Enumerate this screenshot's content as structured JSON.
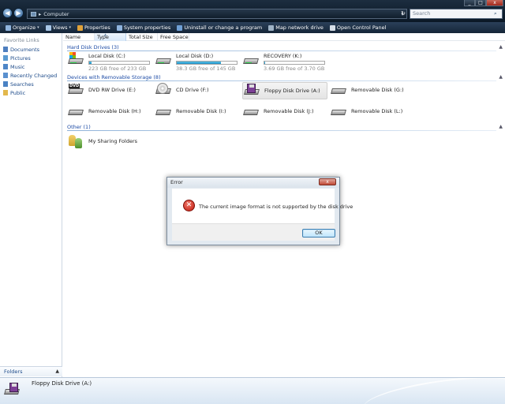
{
  "window": {
    "min_glyph": "_",
    "max_glyph": "□",
    "close_glyph": "x"
  },
  "address": {
    "back_glyph": "◀",
    "forward_glyph": "▶",
    "path": "Computer",
    "separator": "▸",
    "dropdown_glyph": "▾",
    "refresh_glyph": "↻",
    "search_placeholder": "Search",
    "search_glyph": "⌕"
  },
  "toolbar": {
    "items": [
      {
        "label": "Organize",
        "icon": "organize-icon",
        "color": "#8fb4de",
        "caret": "▾"
      },
      {
        "label": "Views",
        "icon": "views-icon",
        "color": "#a8c7e8",
        "caret": "▾"
      },
      {
        "label": "Properties",
        "icon": "properties-icon",
        "color": "#e0a23a",
        "caret": ""
      },
      {
        "label": "System properties",
        "icon": "system-properties-icon",
        "color": "#8fb4de",
        "caret": ""
      },
      {
        "label": "Uninstall or change a program",
        "icon": "uninstall-icon",
        "color": "#6fa0d6",
        "caret": ""
      },
      {
        "label": "Map network drive",
        "icon": "network-drive-icon",
        "color": "#9fb3c6",
        "caret": ""
      },
      {
        "label": "Open Control Panel",
        "icon": "control-panel-icon",
        "color": "#d7dfe8",
        "caret": ""
      }
    ]
  },
  "sidebar": {
    "title": "Favorite Links",
    "items": [
      {
        "label": "Documents",
        "icon": "documents-icon",
        "color": "#4f7fbf"
      },
      {
        "label": "Pictures",
        "icon": "pictures-icon",
        "color": "#5a9ad1"
      },
      {
        "label": "Music",
        "icon": "music-icon",
        "color": "#4e86c7"
      },
      {
        "label": "Recently Changed",
        "icon": "recently-changed-icon",
        "color": "#5a90cf"
      },
      {
        "label": "Searches",
        "icon": "searches-icon",
        "color": "#4a82c3"
      },
      {
        "label": "Public",
        "icon": "public-icon",
        "color": "#e3b84c"
      }
    ],
    "folders_label": "Folders",
    "folders_glyph": "▲"
  },
  "columns": {
    "headers": [
      "Name",
      "Type",
      "Total Size",
      "Free Space"
    ],
    "sort_glyph": "▲"
  },
  "groups": {
    "toggle_glyph": "▲",
    "hard_disk": "Hard Disk Drives (3)",
    "removable": "Devices with Removable Storage (8)",
    "other": "Other (1)"
  },
  "hard_drives": [
    {
      "name": "Local Disk (C:)",
      "free": "223 GB free of 233 GB",
      "used_fraction": 0.04
    },
    {
      "name": "Local Disk (D:)",
      "free": "38.3 GB free of 145 GB",
      "used_fraction": 0.74
    },
    {
      "name": "RECOVERY (K:)",
      "free": "3.69 GB free of 3.70 GB",
      "used_fraction": 0.01
    }
  ],
  "removable": [
    {
      "name": "DVD RW Drive (E:)",
      "badge": "DVD"
    },
    {
      "name": "CD Drive (F:)"
    },
    {
      "name": "Floppy Disk Drive (A:)"
    },
    {
      "name": "Removable Disk (G:)"
    },
    {
      "name": "Removable Disk (H:)"
    },
    {
      "name": "Removable Disk (I:)"
    },
    {
      "name": "Removable Disk (J:)"
    },
    {
      "name": "Removable Disk (L:)"
    }
  ],
  "other": [
    {
      "name": "My Sharing Folders"
    }
  ],
  "details": {
    "name": "Floppy Disk Drive (A:)"
  },
  "dialog": {
    "title": "Error",
    "close_glyph": "x",
    "error_glyph": "✕",
    "message": "The current image format is not supported by the disk drive",
    "ok_label": "OK"
  }
}
